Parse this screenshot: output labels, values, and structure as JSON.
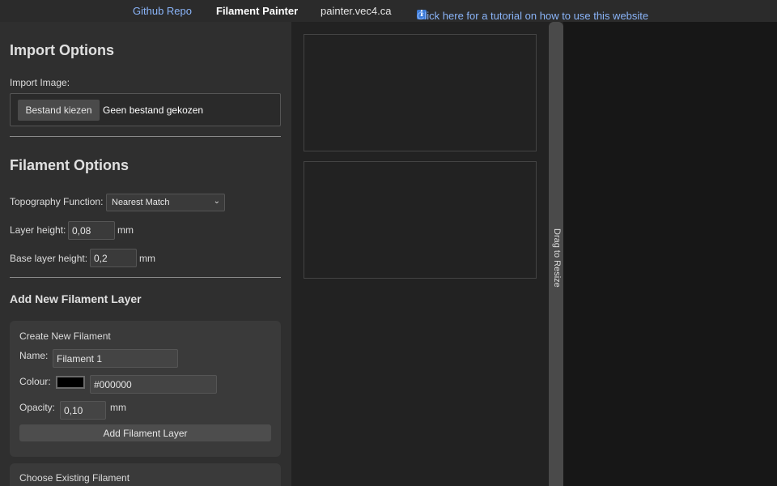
{
  "nav": {
    "github": "Github Repo",
    "title": "Filament Painter",
    "domain": "painter.vec4.ca",
    "tutorial_icon": "info-icon",
    "tutorial": "Click here for a tutorial on how to use this website"
  },
  "import": {
    "title": "Import Options",
    "image_label": "Import Image:",
    "file_button": "Bestand kiezen",
    "file_status": "Geen bestand gekozen"
  },
  "filament": {
    "title": "Filament Options",
    "topo_label": "Topography Function:",
    "topo_value": "Nearest Match",
    "layer_height_label": "Layer height:",
    "layer_height_value": "0,08",
    "layer_height_unit": "mm",
    "base_height_label": "Base layer height:",
    "base_height_value": "0,2",
    "base_height_unit": "mm"
  },
  "add_layer": {
    "title": "Add New Filament Layer",
    "create": {
      "title": "Create New Filament",
      "name_label": "Name:",
      "name_value": "Filament 1",
      "colour_label": "Colour:",
      "colour_swatch": "#000000",
      "colour_value": "#000000",
      "opacity_label": "Opacity:",
      "opacity_value": "0,10",
      "opacity_unit": "mm",
      "add_button": "Add Filament Layer"
    },
    "existing": {
      "title": "Choose Existing Filament"
    }
  },
  "resizer": {
    "label": "Drag to Resize"
  }
}
